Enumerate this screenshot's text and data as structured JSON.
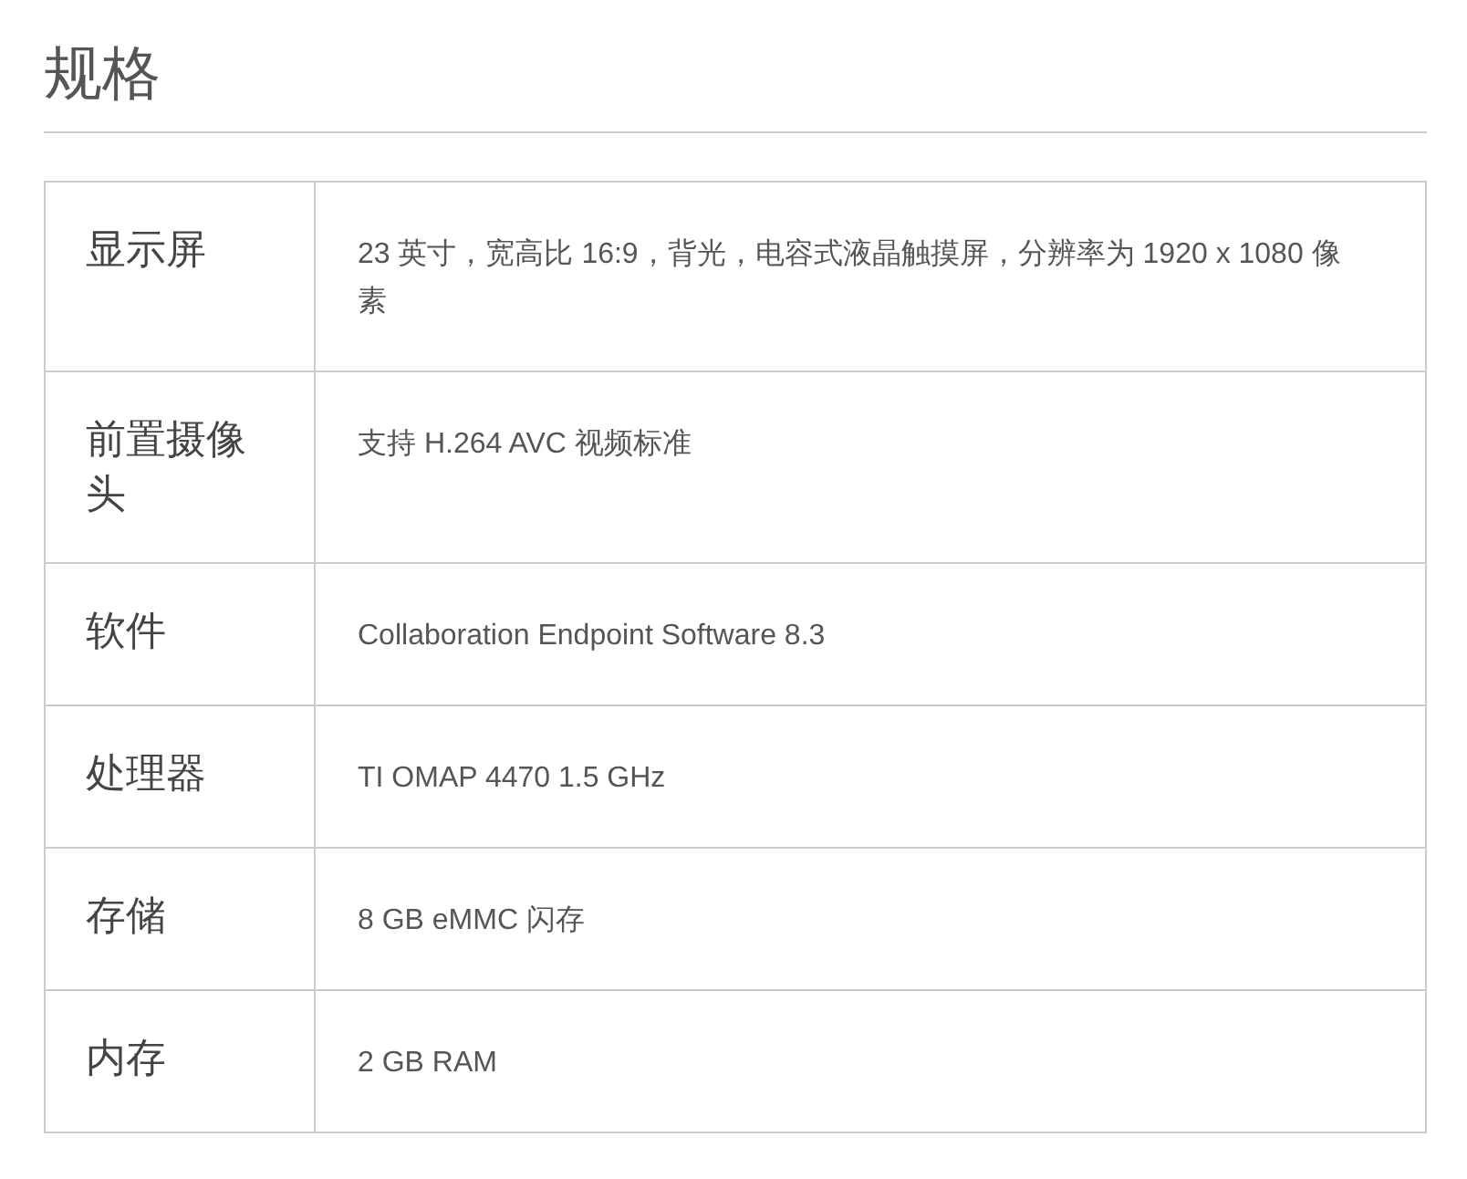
{
  "title": "规格",
  "specs": [
    {
      "label": "显示屏",
      "value": "23 英寸，宽高比 16:9，背光，电容式液晶触摸屏，分辨率为 1920 x 1080 像素"
    },
    {
      "label": "前置摄像头",
      "value": "支持 H.264 AVC 视频标准"
    },
    {
      "label": "软件",
      "value": "Collaboration Endpoint Software 8.3"
    },
    {
      "label": "处理器",
      "value": "TI OMAP 4470 1.5 GHz"
    },
    {
      "label": "存储",
      "value": "8 GB eMMC 闪存"
    },
    {
      "label": "内存",
      "value": "2 GB RAM"
    }
  ]
}
